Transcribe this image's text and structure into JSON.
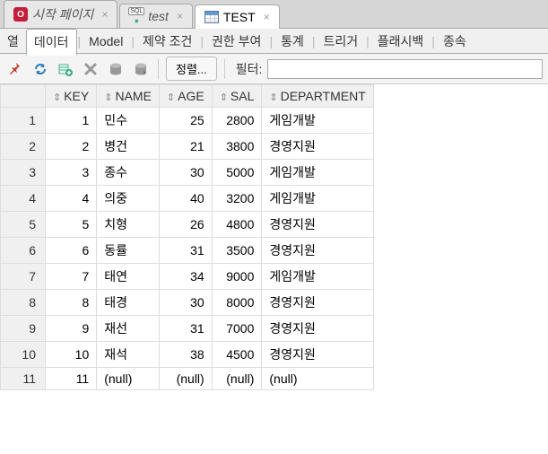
{
  "tabs": [
    {
      "label": "시작 페이지",
      "icon": "oracle"
    },
    {
      "label": "test",
      "icon": "sql"
    },
    {
      "label": "TEST",
      "icon": "table",
      "active": true
    }
  ],
  "subTabs": {
    "items": [
      "열",
      "데이터",
      "Model",
      "제약 조건",
      "권한 부여",
      "통계",
      "트리거",
      "플래시백",
      "종속"
    ],
    "activeIndex": 1
  },
  "toolbar": {
    "sortLabel": "정렬...",
    "filterLabel": "필터:",
    "filterValue": ""
  },
  "columns": [
    "KEY",
    "NAME",
    "AGE",
    "SAL",
    "DEPARTMENT"
  ],
  "rows": [
    {
      "n": 1,
      "key": 1,
      "name": "민수",
      "age": 25,
      "sal": 2800,
      "dept": "게임개발"
    },
    {
      "n": 2,
      "key": 2,
      "name": "병건",
      "age": 21,
      "sal": 3800,
      "dept": "경영지원"
    },
    {
      "n": 3,
      "key": 3,
      "name": "종수",
      "age": 30,
      "sal": 5000,
      "dept": "게임개발"
    },
    {
      "n": 4,
      "key": 4,
      "name": "의중",
      "age": 40,
      "sal": 3200,
      "dept": "게임개발"
    },
    {
      "n": 5,
      "key": 5,
      "name": "치형",
      "age": 26,
      "sal": 4800,
      "dept": "경영지원"
    },
    {
      "n": 6,
      "key": 6,
      "name": "동률",
      "age": 31,
      "sal": 3500,
      "dept": "경영지원"
    },
    {
      "n": 7,
      "key": 7,
      "name": "태연",
      "age": 34,
      "sal": 9000,
      "dept": "게임개발"
    },
    {
      "n": 8,
      "key": 8,
      "name": "태경",
      "age": 30,
      "sal": 8000,
      "dept": "경영지원"
    },
    {
      "n": 9,
      "key": 9,
      "name": "재선",
      "age": 31,
      "sal": 7000,
      "dept": "경영지원"
    },
    {
      "n": 10,
      "key": 10,
      "name": "재석",
      "age": 38,
      "sal": 4500,
      "dept": "경영지원"
    },
    {
      "n": 11,
      "key": 11,
      "name": "(null)",
      "age": "(null)",
      "sal": "(null)",
      "dept": "(null)"
    }
  ]
}
